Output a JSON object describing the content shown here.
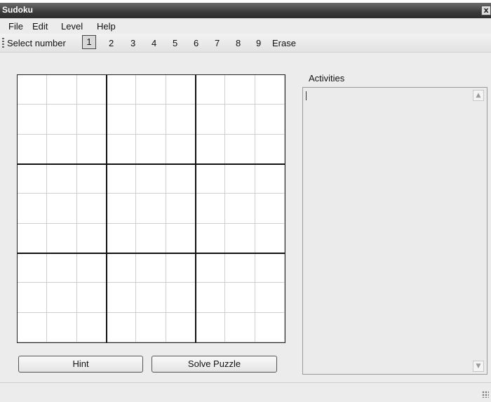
{
  "window": {
    "title": "Sudoku",
    "close_glyph": "x"
  },
  "menu": {
    "items": [
      "File",
      "Edit",
      "Level",
      "Help"
    ]
  },
  "toolbar": {
    "select_label": "Select number",
    "numbers": [
      "1",
      "2",
      "3",
      "4",
      "5",
      "6",
      "7",
      "8",
      "9"
    ],
    "selected_number": "1",
    "erase_label": "Erase"
  },
  "board": {
    "size": 9,
    "cells": [
      [
        "",
        "",
        "",
        "",
        "",
        "",
        "",
        "",
        ""
      ],
      [
        "",
        "",
        "",
        "",
        "",
        "",
        "",
        "",
        ""
      ],
      [
        "",
        "",
        "",
        "",
        "",
        "",
        "",
        "",
        ""
      ],
      [
        "",
        "",
        "",
        "",
        "",
        "",
        "",
        "",
        ""
      ],
      [
        "",
        "",
        "",
        "",
        "",
        "",
        "",
        "",
        ""
      ],
      [
        "",
        "",
        "",
        "",
        "",
        "",
        "",
        "",
        ""
      ],
      [
        "",
        "",
        "",
        "",
        "",
        "",
        "",
        "",
        ""
      ],
      [
        "",
        "",
        "",
        "",
        "",
        "",
        "",
        "",
        ""
      ],
      [
        "",
        "",
        "",
        "",
        "",
        "",
        "",
        "",
        ""
      ]
    ]
  },
  "buttons": {
    "hint": "Hint",
    "solve": "Solve Puzzle"
  },
  "activities": {
    "label": "Activities",
    "text": ""
  },
  "icons": {
    "grip": "toolbar-grip-icon",
    "scroll_up": "chevron-up-icon",
    "scroll_down": "chevron-down-icon",
    "resize": "resize-grip-icon"
  }
}
